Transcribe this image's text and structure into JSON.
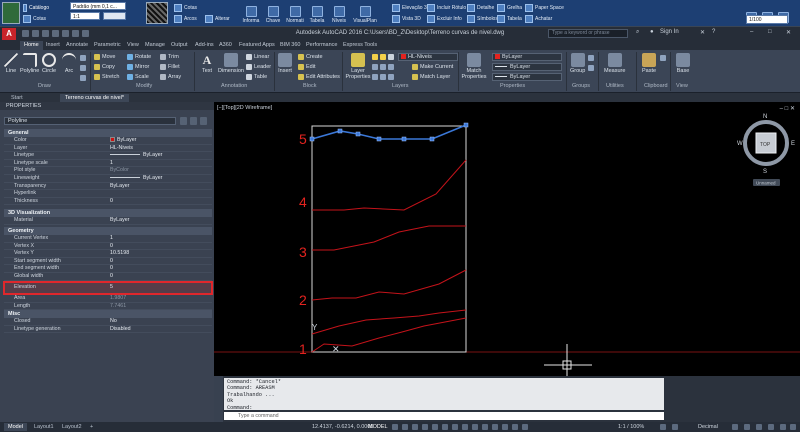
{
  "plugin_bar": {
    "field_a": "Padrão (mm 0,1 c...",
    "field_b": "1:1",
    "hint": "Clique no ITEM para mais informações",
    "left_labels": [
      "Catálogo",
      "Cotas"
    ],
    "stamp_label": "Alterar",
    "mini_labels": [
      "Cotas",
      "Arcos"
    ],
    "buttons": [
      "Informa",
      "Chave",
      "Normati",
      "Tabela",
      "Níveis",
      "VisualPlan"
    ],
    "right_top": [
      "Elevação 3D",
      "Incluir Rótulo",
      "Detalhe",
      "Grelha",
      "Paper Space"
    ],
    "right_bot": [
      "Vista 3D",
      "Excluir Info",
      "Símbolos",
      "Tabela",
      "Achatar"
    ],
    "scale_field": "1/100"
  },
  "titlebar": {
    "title": "Autodesk AutoCAD 2016    C:\\Users\\BD_Z\\Desktop\\Terreno curvas de nivel.dwg",
    "search_placeholder": "Type a keyword or phrase",
    "sign_in": "Sign In"
  },
  "menu_tabs": [
    "Home",
    "Insert",
    "Annotate",
    "Parametric",
    "View",
    "Manage",
    "Output",
    "Add-ins",
    "A360",
    "Featured Apps",
    "BIM 360",
    "Performance",
    "Express Tools"
  ],
  "ribbon": {
    "draw": {
      "line": "Line",
      "polyline": "Polyline",
      "circle": "Circle",
      "arc": "Arc",
      "label": "Draw"
    },
    "modify": {
      "items": [
        "Move",
        "Rotate",
        "Trim",
        "Copy",
        "Mirror",
        "Fillet",
        "Stretch",
        "Scale",
        "Array"
      ],
      "label": "Modify"
    },
    "annotation": {
      "text": "Text",
      "dimension": "Dimension",
      "items": [
        "Linear",
        "Leader",
        "Table"
      ],
      "label": "Annotation"
    },
    "block": {
      "insert": "Insert",
      "items": [
        "Create",
        "Edit",
        "Edit Attributes"
      ],
      "label": "Block"
    },
    "layers": {
      "props": "Layer Properties",
      "combo": "HL-Niveis",
      "items": [
        "Make Current",
        "Match Layer"
      ],
      "label": "Layers"
    },
    "properties": {
      "match": "Match Properties",
      "combos": [
        "ByLayer",
        "ByLayer",
        "ByLayer"
      ],
      "label": "Properties"
    },
    "groups": {
      "group": "Group",
      "label": "Groups"
    },
    "utilities": {
      "measure": "Measure",
      "label": "Utilities"
    },
    "clipboard": {
      "paste": "Paste",
      "label": "Clipboard"
    },
    "view": {
      "base": "Base",
      "label": "View"
    }
  },
  "doc_tabs": [
    "Start",
    "Terreno curvas de nivel*"
  ],
  "properties_panel": {
    "title": "PROPERTIES",
    "object": "Polyline",
    "sections": {
      "general": {
        "title": "General",
        "rows": [
          {
            "k": "Color",
            "v": "ByLayer"
          },
          {
            "k": "Layer",
            "v": "HL-Niveis"
          },
          {
            "k": "Linetype",
            "v": "ByLayer"
          },
          {
            "k": "Linetype scale",
            "v": "1"
          },
          {
            "k": "Plot style",
            "v": "ByColor"
          },
          {
            "k": "Lineweight",
            "v": "ByLayer"
          },
          {
            "k": "Transparency",
            "v": "ByLayer"
          },
          {
            "k": "Hyperlink",
            "v": ""
          },
          {
            "k": "Thickness",
            "v": "0"
          }
        ]
      },
      "visualization": {
        "title": "3D Visualization",
        "rows": [
          {
            "k": "Material",
            "v": "ByLayer"
          }
        ]
      },
      "geometry": {
        "title": "Geometry",
        "rows": [
          {
            "k": "Current Vertex",
            "v": "1"
          },
          {
            "k": "Vertex X",
            "v": "0"
          },
          {
            "k": "Vertex Y",
            "v": "10.5198"
          },
          {
            "k": "Start segment width",
            "v": "0"
          },
          {
            "k": "End segment width",
            "v": "0"
          },
          {
            "k": "Global width",
            "v": "0"
          },
          {
            "k": "Elevation",
            "v": "5"
          },
          {
            "k": "Area",
            "v": "1.9807"
          },
          {
            "k": "Length",
            "v": "7.7461"
          }
        ]
      },
      "misc": {
        "title": "Misc",
        "rows": [
          {
            "k": "Closed",
            "v": "No"
          },
          {
            "k": "Linetype generation",
            "v": "Disabled"
          }
        ]
      }
    }
  },
  "viewport": {
    "label": "[−][Top][2D Wireframe]",
    "level_labels": [
      "5",
      "4",
      "3",
      "2",
      "1"
    ],
    "ucs_y": "Y",
    "viewcube": {
      "top": "TOP",
      "n": "N",
      "s": "S",
      "e": "E",
      "w": "W",
      "wcs": "Unnamed"
    },
    "accent": "#e3231f"
  },
  "command": {
    "history": [
      "Command: *Cancel*",
      "Command: AREASM",
      "Trabalhando ...",
      "Ok",
      "Command:"
    ],
    "placeholder": "Type a command"
  },
  "status": {
    "tabs": [
      "Model",
      "Layout1",
      "Layout2"
    ],
    "coords": "12.4137, -0.6214, 0.0000",
    "model": "MODEL",
    "scale": "1:1 / 100%",
    "units": "Decimal"
  }
}
